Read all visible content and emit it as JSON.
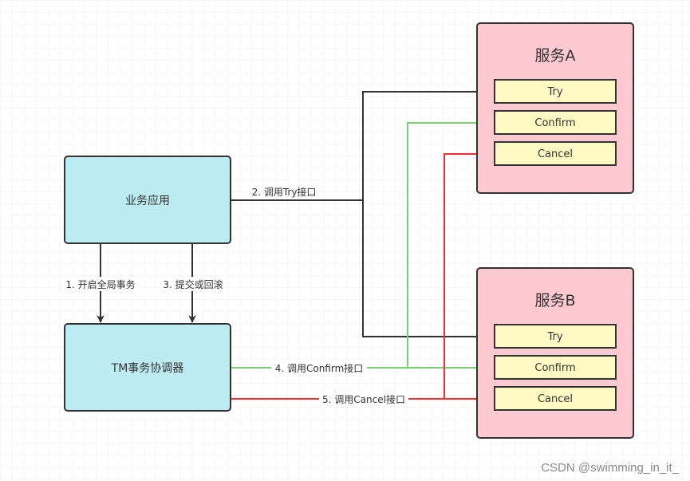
{
  "nodes": {
    "app": "业务应用",
    "tm": "TM事务协调器",
    "service_a": {
      "title": "服务A",
      "methods": [
        "Try",
        "Confirm",
        "Cancel"
      ]
    },
    "service_b": {
      "title": "服务B",
      "methods": [
        "Try",
        "Confirm",
        "Cancel"
      ]
    }
  },
  "edges": {
    "begin": "1. 开启全局事务",
    "try": "2. 调用Try接口",
    "commit": "3. 提交或回滚",
    "confirm": "4. 调用Confirm接口",
    "cancel": "5. 调用Cancel接口"
  },
  "colors": {
    "app": "#bcebf1",
    "service": "#ffc9d2",
    "method": "#fffac4",
    "try_line": "#333333",
    "confirm_line": "#7fcc7a",
    "cancel_line": "#ee2f36"
  },
  "watermark": "CSDN @swimming_in_it_"
}
